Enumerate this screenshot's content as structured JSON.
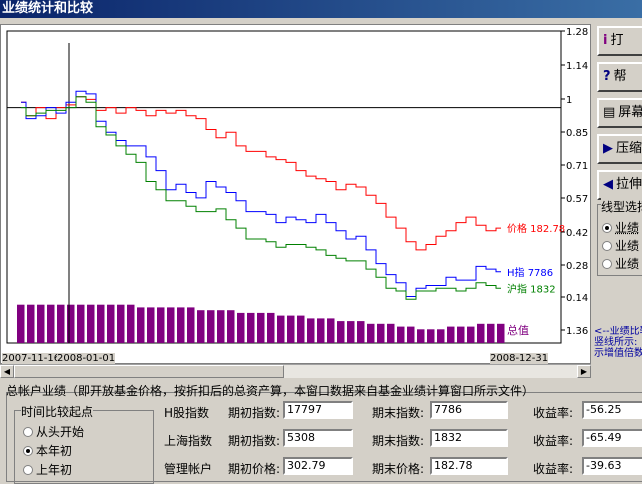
{
  "window": {
    "title": "业绩统计和比较"
  },
  "side_buttons": [
    {
      "icon": "i",
      "label": "打"
    },
    {
      "icon": "?",
      "label": "帮"
    },
    {
      "icon": "▤",
      "label": "屏幕"
    },
    {
      "icon": "▶",
      "label": "压缩"
    },
    {
      "icon": "◀",
      "label": "拉伸"
    }
  ],
  "line_type": {
    "legend": "线型选择",
    "options": [
      {
        "label": "业绩",
        "selected": true
      },
      {
        "label": "业绩",
        "selected": false
      },
      {
        "label": "业绩",
        "selected": false
      }
    ]
  },
  "note": [
    "<--业绩比较",
    "竖线所示:",
    "示增值倍数"
  ],
  "chart_data": {
    "type": "line",
    "x_start_label": "2007-11-16",
    "cursor_date_label": "2008-01-01",
    "x_end_label": "2008-12-31",
    "y_ticks": [
      "1.28",
      "1.14",
      "1",
      "0.85",
      "0.71",
      "0.57",
      "0.42",
      "0.28",
      "0.14",
      "1.36"
    ],
    "ylim": [
      0.14,
      1.28
    ],
    "series": [
      {
        "name": "价格",
        "label": "价格 182.78",
        "color": "#ff0000",
        "values": [
          1.02,
          0.97,
          1.0,
          0.96,
          1.0,
          1.01,
          1.04,
          1.03,
          0.99,
          1.0,
          0.98,
          1.0,
          0.99,
          0.97,
          0.99,
          0.98,
          0.99,
          0.97,
          0.96,
          0.92,
          0.89,
          0.91,
          0.86,
          0.84,
          0.84,
          0.82,
          0.81,
          0.8,
          0.77,
          0.75,
          0.74,
          0.73,
          0.7,
          0.72,
          0.71,
          0.68,
          0.65,
          0.6,
          0.56,
          0.51,
          0.48,
          0.5,
          0.53,
          0.55,
          0.58,
          0.6,
          0.57,
          0.55,
          0.56
        ]
      },
      {
        "name": "H指",
        "label": "H指 7786",
        "color": "#0000ff",
        "values": [
          1.02,
          0.96,
          0.97,
          1.0,
          0.98,
          1.02,
          1.06,
          1.05,
          0.95,
          0.91,
          0.88,
          0.86,
          0.86,
          0.82,
          0.77,
          0.7,
          0.72,
          0.69,
          0.67,
          0.73,
          0.71,
          0.69,
          0.66,
          0.62,
          0.62,
          0.61,
          0.58,
          0.6,
          0.59,
          0.58,
          0.61,
          0.58,
          0.55,
          0.52,
          0.53,
          0.48,
          0.43,
          0.39,
          0.36,
          0.31,
          0.34,
          0.35,
          0.35,
          0.38,
          0.37,
          0.37,
          0.42,
          0.41,
          0.4
        ]
      },
      {
        "name": "沪指",
        "label": "沪指 1832",
        "color": "#008000",
        "values": [
          1.0,
          0.97,
          0.98,
          0.99,
          0.99,
          1.0,
          1.04,
          1.02,
          0.93,
          0.9,
          0.86,
          0.83,
          0.8,
          0.73,
          0.7,
          0.66,
          0.66,
          0.64,
          0.62,
          0.62,
          0.63,
          0.59,
          0.56,
          0.52,
          0.52,
          0.51,
          0.49,
          0.5,
          0.5,
          0.49,
          0.48,
          0.46,
          0.45,
          0.44,
          0.44,
          0.41,
          0.38,
          0.34,
          0.33,
          0.3,
          0.33,
          0.33,
          0.34,
          0.34,
          0.33,
          0.34,
          0.36,
          0.35,
          0.34
        ]
      }
    ],
    "bars": {
      "name": "总值",
      "label": "总值",
      "color": "#800080",
      "values": [
        0.28,
        0.28,
        0.28,
        0.28,
        0.28,
        0.28,
        0.28,
        0.28,
        0.28,
        0.28,
        0.28,
        0.28,
        0.27,
        0.27,
        0.27,
        0.27,
        0.27,
        0.27,
        0.26,
        0.26,
        0.26,
        0.26,
        0.25,
        0.25,
        0.25,
        0.25,
        0.24,
        0.24,
        0.24,
        0.23,
        0.23,
        0.23,
        0.22,
        0.22,
        0.22,
        0.21,
        0.21,
        0.21,
        0.2,
        0.2,
        0.19,
        0.19,
        0.19,
        0.2,
        0.2,
        0.2,
        0.21,
        0.21,
        0.21
      ]
    },
    "reference_line": 1.0,
    "cursor_index": 4
  },
  "description": "总帐户业绩（即开放基金价格，按折扣后的总资产算，本窗口数据来自基金业绩计算窗口所示文件）",
  "time_group": {
    "legend": "时间比较起点",
    "options": [
      {
        "label": "从头开始",
        "selected": false
      },
      {
        "label": "本年初",
        "selected": true
      },
      {
        "label": "上年初",
        "selected": false
      }
    ]
  },
  "rows": [
    {
      "name": "H股指数",
      "start_label": "期初指数:",
      "start_value": "17797",
      "end_label": "期末指数:",
      "end_value": "7786",
      "ret_label": "收益率:",
      "ret_value": "-56.25"
    },
    {
      "name": "上海指数",
      "start_label": "期初指数:",
      "start_value": "5308",
      "end_label": "期末指数:",
      "end_value": "1832",
      "ret_label": "收益率:",
      "ret_value": "-65.49"
    },
    {
      "name": "管理帐户",
      "start_label": "期初价格:",
      "start_value": "302.79",
      "end_label": "期末价格:",
      "end_value": "182.78",
      "ret_label": "收益率:",
      "ret_value": "-39.63"
    }
  ]
}
